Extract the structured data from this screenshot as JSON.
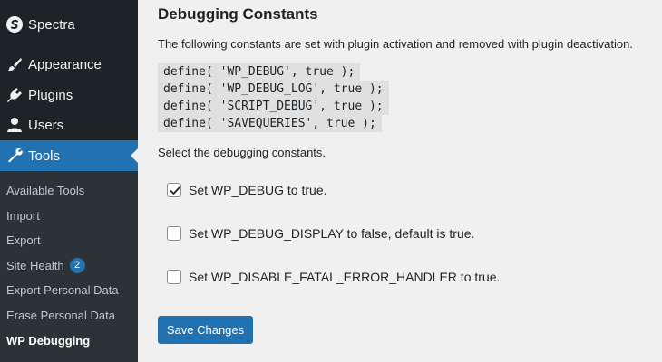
{
  "sidebar": {
    "items": [
      {
        "label": "Spectra",
        "icon": "spectra-icon"
      },
      {
        "label": "Appearance",
        "icon": "paintbrush-icon"
      },
      {
        "label": "Plugins",
        "icon": "plugin-icon"
      },
      {
        "label": "Users",
        "icon": "user-icon"
      },
      {
        "label": "Tools",
        "icon": "wrench-icon",
        "active": true
      }
    ],
    "submenu": [
      {
        "label": "Available Tools"
      },
      {
        "label": "Import"
      },
      {
        "label": "Export"
      },
      {
        "label": "Site Health",
        "badge": "2"
      },
      {
        "label": "Export Personal Data"
      },
      {
        "label": "Erase Personal Data"
      },
      {
        "label": "WP Debugging",
        "current": true
      }
    ]
  },
  "main": {
    "title": "Debugging Constants",
    "description": "The following constants are set with plugin activation and removed with plugin deactivation.",
    "code_lines": [
      "define( 'WP_DEBUG', true );",
      "define( 'WP_DEBUG_LOG', true );",
      "define( 'SCRIPT_DEBUG', true );",
      "define( 'SAVEQUERIES', true );"
    ],
    "select_label": "Select the debugging constants.",
    "options": [
      {
        "label": "Set WP_DEBUG to true.",
        "checked": true
      },
      {
        "label": "Set WP_DEBUG_DISPLAY to false, default is true.",
        "checked": false
      },
      {
        "label": "Set WP_DISABLE_FATAL_ERROR_HANDLER to true.",
        "checked": false
      }
    ],
    "save_label": "Save Changes"
  },
  "colors": {
    "accent": "#2271b1",
    "sidebar_bg": "#1d2327",
    "submenu_bg": "#2c3338",
    "page_bg": "#f0f0f1"
  }
}
